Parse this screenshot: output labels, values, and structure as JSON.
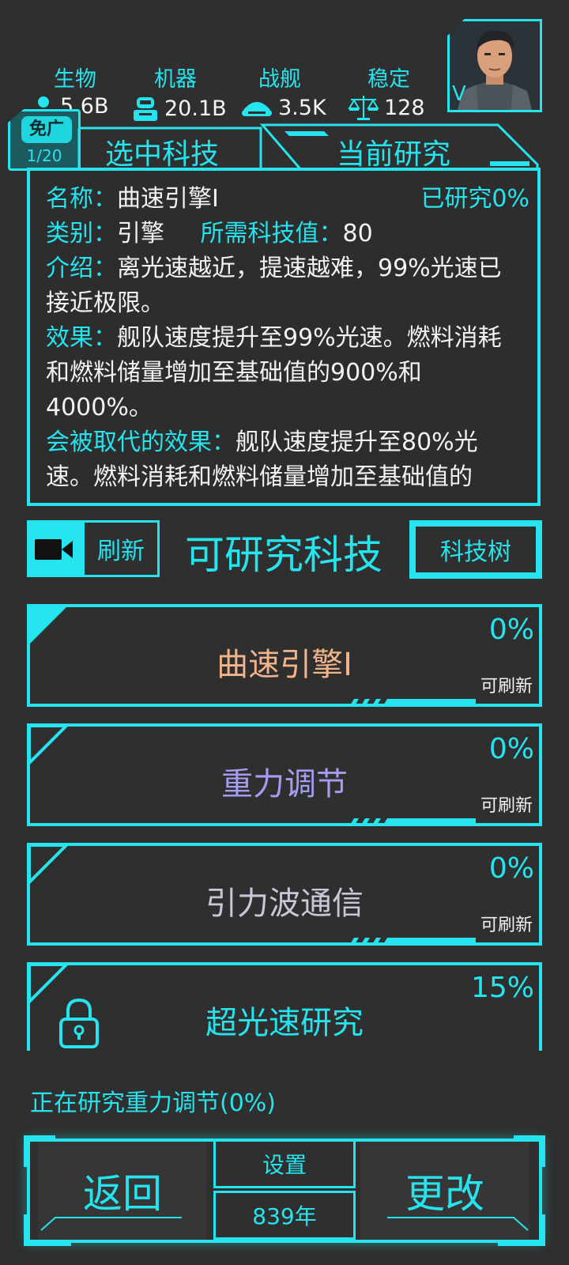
{
  "resources": [
    {
      "label": "生物",
      "value": "5.6B",
      "icon": "person-icon"
    },
    {
      "label": "机器",
      "value": "20.1B",
      "icon": "robot-icon"
    },
    {
      "label": "战舰",
      "value": "3.5K",
      "icon": "ship-icon"
    },
    {
      "label": "稳定",
      "value": "128",
      "icon": "scales-icon"
    }
  ],
  "portrait": {
    "label": "V"
  },
  "ad_free": {
    "label": "免广",
    "count": "1/20"
  },
  "tabs": {
    "selected": "选中科技",
    "current": "当前研究"
  },
  "tech_info": {
    "name_key": "名称：",
    "name_value": "曲速引擎I",
    "researched": "已研究0%",
    "category_key": "类别：",
    "category_value": "引擎",
    "cost_key": "所需科技值：",
    "cost_value": "80",
    "intro_key": "介绍：",
    "intro_value": "离光速越近，提速越难，99%光速已接近极限。",
    "effect_key": "效果：",
    "effect_value": "舰队速度提升至99%光速。燃料消耗和燃料储量增加至基础值的900%和4000%。",
    "replaced_key": "会被取代的效果：",
    "replaced_value": "舰队速度提升至80%光速。燃料消耗和燃料储量增加至基础值的"
  },
  "toolbar": {
    "refresh": "刷新",
    "title": "可研究科技",
    "tech_tree": "科技树"
  },
  "cards": [
    {
      "name": "曲速引擎I",
      "percent": "0%",
      "hint": "可刷新",
      "color": "#f2b48a",
      "selected": true
    },
    {
      "name": "重力调节",
      "percent": "0%",
      "hint": "可刷新",
      "color": "#a49cf0",
      "selected": false
    },
    {
      "name": "引力波通信",
      "percent": "0%",
      "hint": "可刷新",
      "color": "#c7c7d7",
      "selected": false
    },
    {
      "name": "超光速研究",
      "percent": "15%",
      "hint": "",
      "color": "#25e4ee",
      "locked": true
    }
  ],
  "status": "正在研究重力调节(0%)",
  "bottom": {
    "back": "返回",
    "settings": "设置",
    "year": "839年",
    "change": "更改"
  },
  "colors": {
    "accent": "#25e4ee",
    "background": "#2f2f2f"
  }
}
